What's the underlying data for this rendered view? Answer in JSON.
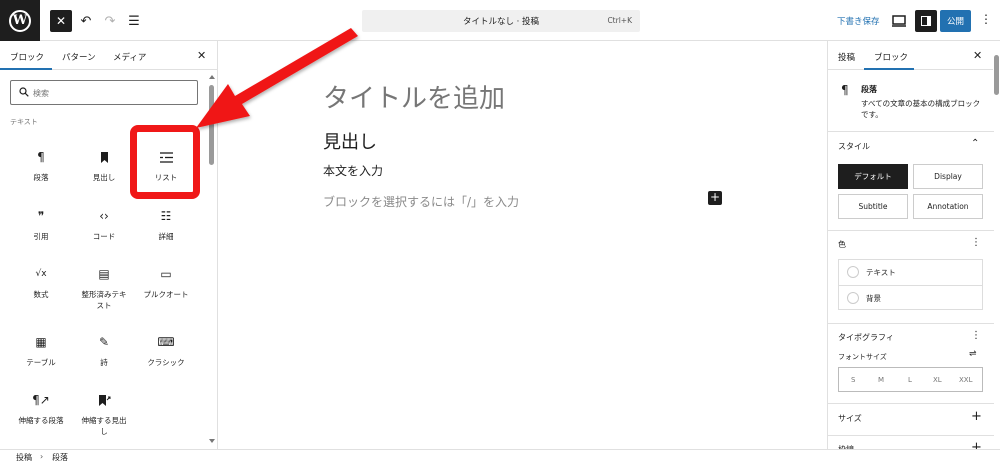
{
  "topbar": {
    "close_icon": "close-icon",
    "undo_icon": "undo-icon",
    "redo_icon": "redo-icon",
    "list_view_icon": "list-view-icon",
    "command_title": "タイトルなし · 投稿",
    "command_shortcut": "Ctrl+K",
    "save_draft": "下書き保存",
    "publish": "公開"
  },
  "inserter": {
    "tabs": [
      "ブロック",
      "パターン",
      "メディア"
    ],
    "search_placeholder": "検索",
    "category": "テキスト",
    "blocks": [
      {
        "label": "段落",
        "icon": "¶"
      },
      {
        "label": "見出し",
        "icon": "🔖"
      },
      {
        "label": "リスト",
        "icon": "☰"
      },
      {
        "label": "引用",
        "icon": "❞"
      },
      {
        "label": "コード",
        "icon": "‹›"
      },
      {
        "label": "詳細",
        "icon": "☷"
      },
      {
        "label": "数式",
        "icon": "√x"
      },
      {
        "label": "整形済みテキ\nスト",
        "icon": "▤"
      },
      {
        "label": "プルクオート",
        "icon": "▭"
      },
      {
        "label": "テーブル",
        "icon": "▦"
      },
      {
        "label": "詩",
        "icon": "✎"
      },
      {
        "label": "クラシック",
        "icon": "⌨"
      },
      {
        "label": "伸縮する段落",
        "icon": "¶↗"
      },
      {
        "label": "伸縮する見出\nし",
        "icon": "↗"
      }
    ]
  },
  "canvas": {
    "title_placeholder": "タイトルを追加",
    "heading": "見出し",
    "paragraph": "本文を入力",
    "block_placeholder": "ブロックを選択するには「/」を入力",
    "add_block": "+"
  },
  "settings": {
    "tabs": [
      "投稿",
      "ブロック"
    ],
    "block_name": "段落",
    "block_desc": "すべての文章の基本の構成ブロックです。",
    "style_title": "スタイル",
    "styles": [
      "デフォルト",
      "Display",
      "Subtitle",
      "Annotation"
    ],
    "color_title": "色",
    "colors": [
      "テキスト",
      "背景"
    ],
    "typography_title": "タイポグラフィ",
    "font_size_label": "フォントサイズ",
    "font_sizes": [
      "S",
      "M",
      "L",
      "XL",
      "XXL"
    ],
    "dimensions_title": "サイズ",
    "border_title": "枠線"
  },
  "footer": {
    "crumbs": [
      "投稿",
      "段落"
    ]
  },
  "colors": {
    "accent": "#2271b1",
    "highlight": "#f01818",
    "dark": "#1e1e1e"
  }
}
